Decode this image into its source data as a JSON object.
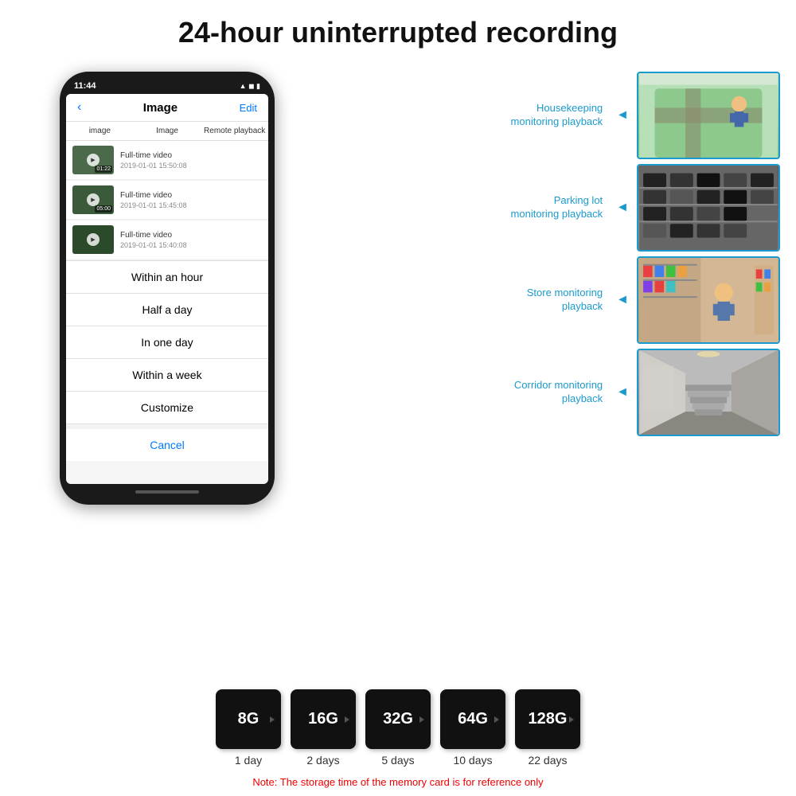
{
  "page": {
    "title": "24-hour uninterrupted recording"
  },
  "phone": {
    "time": "11:44",
    "icons": "▲ ◼ ▮",
    "header": {
      "back": "‹",
      "title": "Image",
      "edit": "Edit"
    },
    "tabs": [
      "image",
      "Image",
      "Remote playback"
    ],
    "videos": [
      {
        "title": "Full-time video",
        "date": "2019-01-01 15:50:08",
        "duration": "01:22"
      },
      {
        "title": "Full-time video",
        "date": "2019-01-01 15:45:08",
        "duration": "05:00"
      },
      {
        "title": "Full-time video",
        "date": "2019-01-01 15:40:08",
        "duration": ""
      }
    ],
    "action_sheet": {
      "items": [
        "Within an hour",
        "Half a day",
        "In one day",
        "Within a week",
        "Customize"
      ],
      "cancel": "Cancel"
    }
  },
  "monitoring": [
    {
      "label": "Housekeeping\nmonitoring playback",
      "id": "housekeeping"
    },
    {
      "label": "Parking lot\nmonitoring playback",
      "id": "parking"
    },
    {
      "label": "Store monitoring\nplayback",
      "id": "store"
    },
    {
      "label": "Corridor monitoring\nplayback",
      "id": "corridor"
    }
  ],
  "sd_cards": [
    {
      "size": "8G",
      "days": "1 day"
    },
    {
      "size": "16G",
      "days": "2 days"
    },
    {
      "size": "32G",
      "days": "5 days"
    },
    {
      "size": "64G",
      "days": "10 days"
    },
    {
      "size": "128G",
      "days": "22 days"
    }
  ],
  "note": "Note: The storage time of the memory card is for reference only"
}
